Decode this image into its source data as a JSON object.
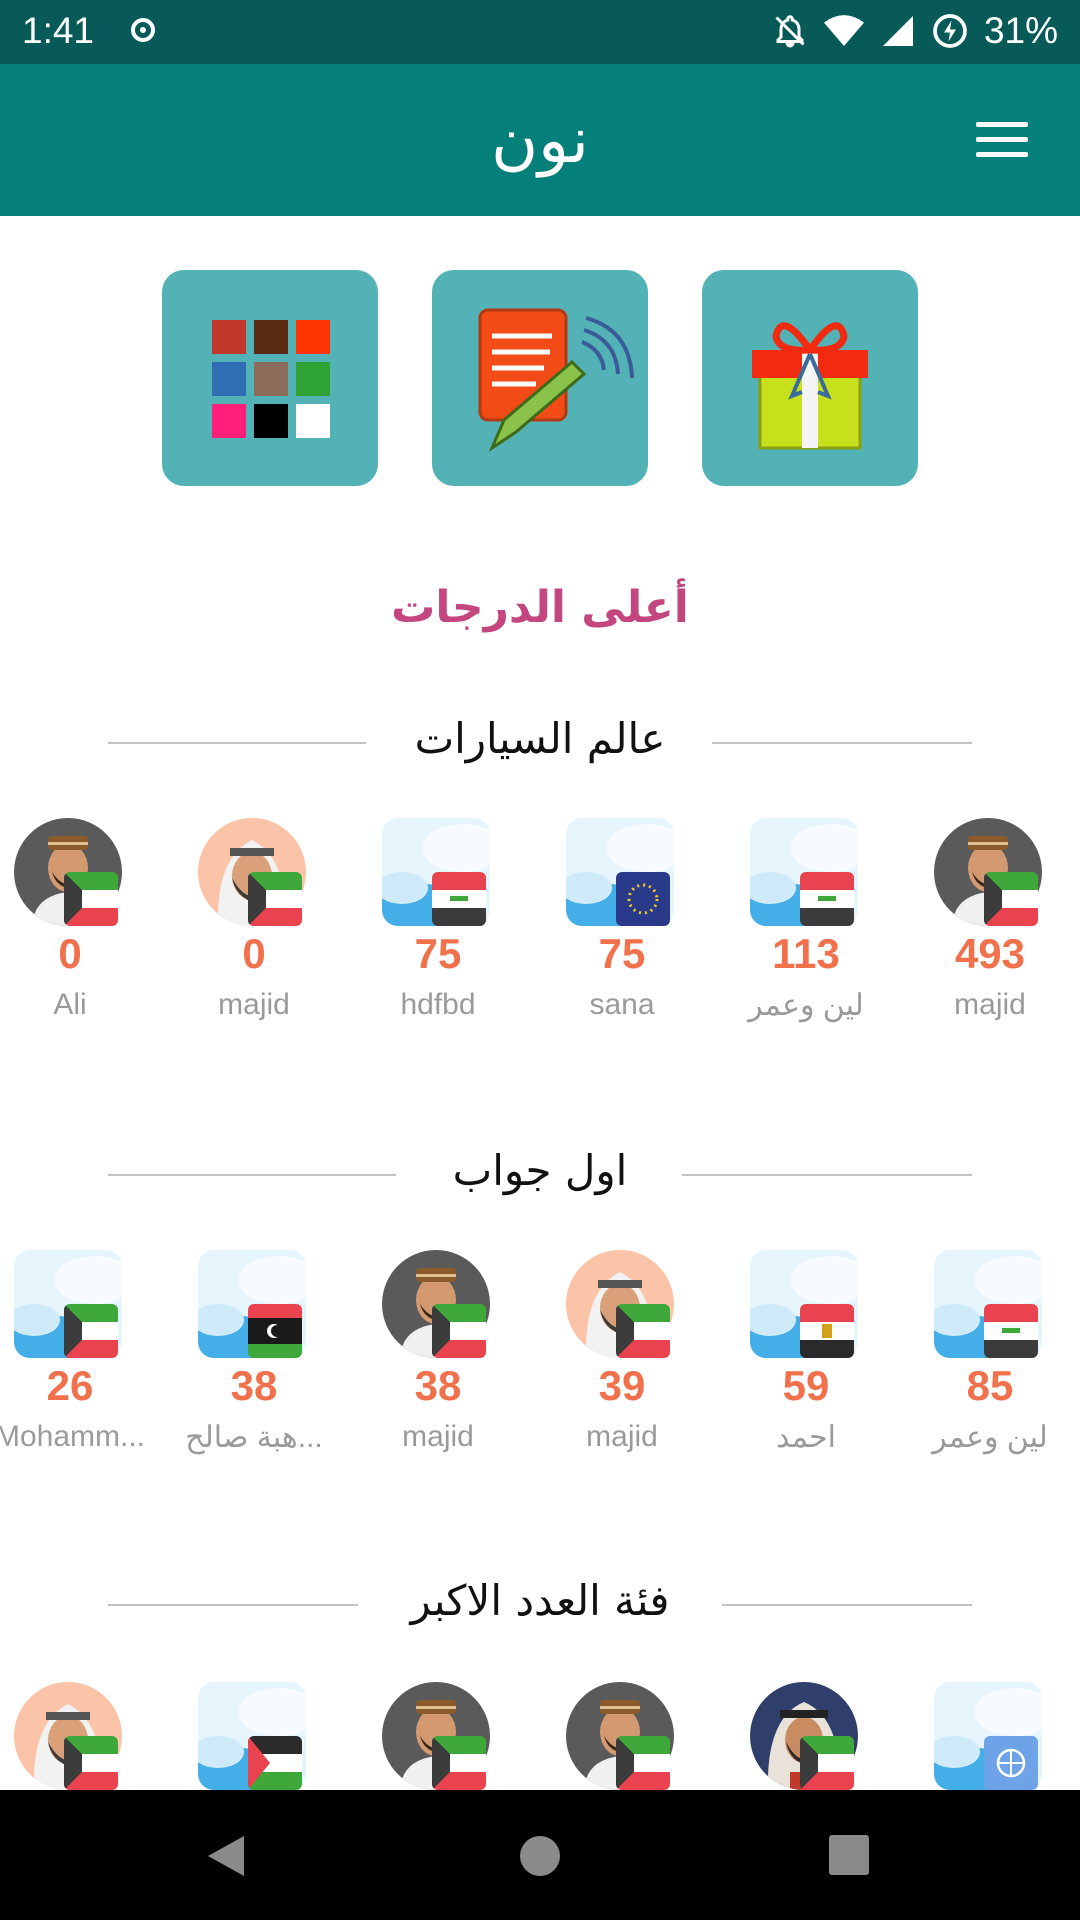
{
  "status_bar": {
    "time": "1:41",
    "battery": "31%"
  },
  "app_bar": {
    "title": "نون"
  },
  "tiles": [
    {
      "name": "colors",
      "icon": "color-grid-icon"
    },
    {
      "name": "notes",
      "icon": "notepad-pen-icon"
    },
    {
      "name": "gifts",
      "icon": "gift-box-icon"
    }
  ],
  "section_title": "أعلى الدرجات",
  "categories": [
    {
      "title": "عالم السيارات",
      "players": [
        {
          "name": "Ali",
          "score": "0",
          "avatar": "man-cap",
          "flag": "kuwait"
        },
        {
          "name": "majid",
          "score": "0",
          "avatar": "man-keffiyeh",
          "flag": "kuwait"
        },
        {
          "name": "hdfbd",
          "score": "75",
          "avatar": "sky",
          "flag": "iraq"
        },
        {
          "name": "sana",
          "score": "75",
          "avatar": "sky",
          "flag": "eu"
        },
        {
          "name": "لين وعمر",
          "score": "113",
          "avatar": "sky",
          "flag": "iraq"
        },
        {
          "name": "majid",
          "score": "493",
          "avatar": "man-cap",
          "flag": "kuwait"
        }
      ]
    },
    {
      "title": "اول جواب",
      "players": [
        {
          "name": "Mohamm...",
          "score": "26",
          "avatar": "sky",
          "flag": "kuwait"
        },
        {
          "name": "هبة صالح...",
          "score": "38",
          "avatar": "sky",
          "flag": "libya"
        },
        {
          "name": "majid",
          "score": "38",
          "avatar": "man-cap",
          "flag": "kuwait"
        },
        {
          "name": "majid",
          "score": "39",
          "avatar": "man-keffiyeh",
          "flag": "kuwait"
        },
        {
          "name": "احمد",
          "score": "59",
          "avatar": "sky",
          "flag": "egypt"
        },
        {
          "name": "لين وعمر",
          "score": "85",
          "avatar": "sky",
          "flag": "iraq"
        }
      ]
    },
    {
      "title": "فئة العدد الاكبر",
      "players": [
        {
          "name": "",
          "score": "",
          "avatar": "man-keffiyeh",
          "flag": "kuwait"
        },
        {
          "name": "",
          "score": "",
          "avatar": "sky",
          "flag": "palestine"
        },
        {
          "name": "",
          "score": "",
          "avatar": "man-cap",
          "flag": "kuwait"
        },
        {
          "name": "",
          "score": "",
          "avatar": "man-cap",
          "flag": "kuwait"
        },
        {
          "name": "",
          "score": "",
          "avatar": "man-shemagh",
          "flag": "kuwait"
        },
        {
          "name": "",
          "score": "",
          "avatar": "sky",
          "flag": "un"
        }
      ]
    }
  ],
  "nav_bar": {
    "back": "back-triangle-icon",
    "home": "home-circle-icon",
    "recents": "recents-square-icon"
  }
}
